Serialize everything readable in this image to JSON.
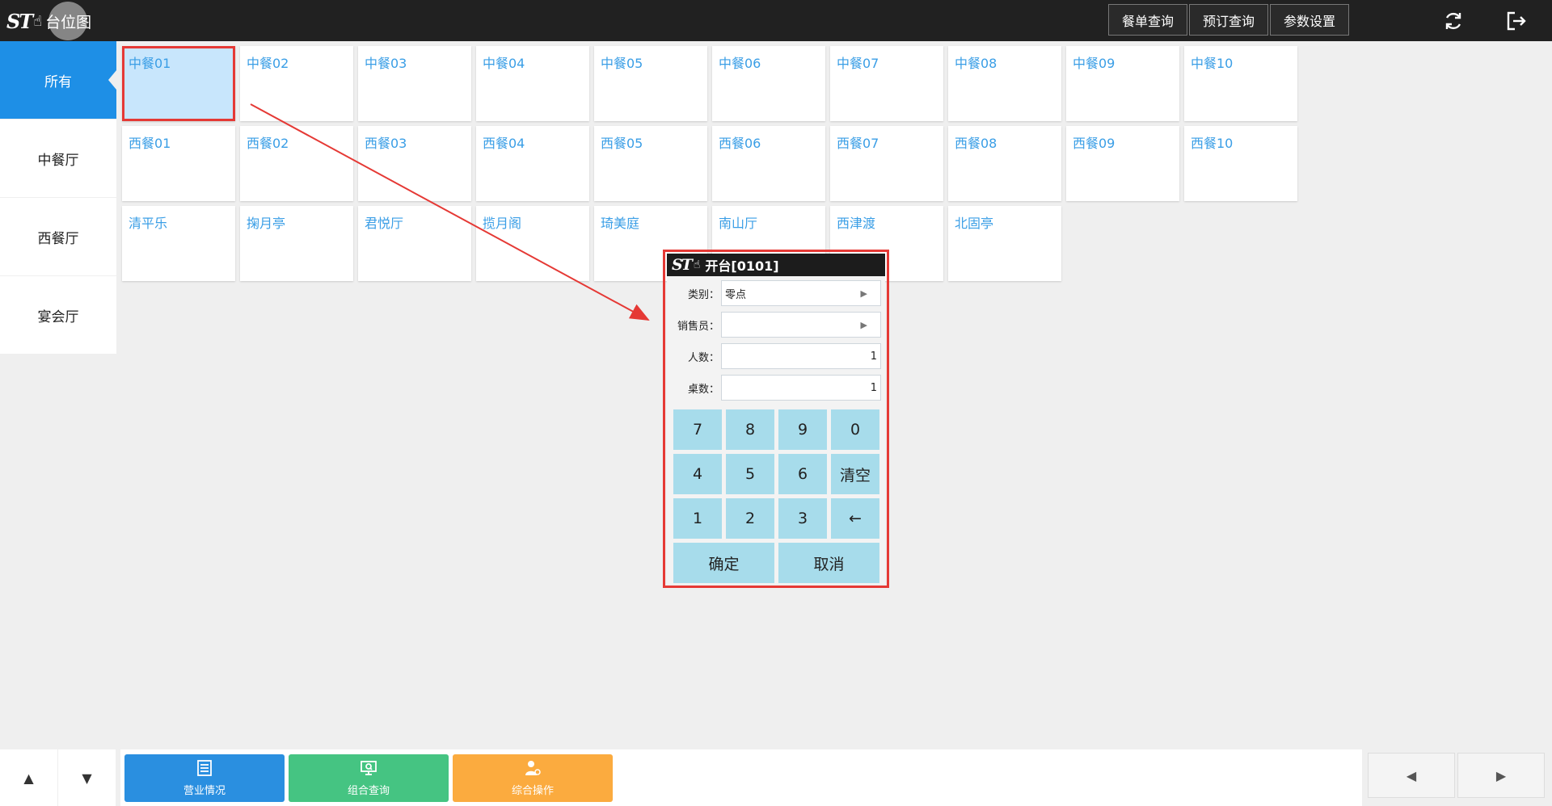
{
  "app": {
    "title": "台位图"
  },
  "topnav": {
    "items": [
      "餐单查询",
      "预订查询",
      "参数设置"
    ]
  },
  "sidebar": {
    "items": [
      {
        "label": "所有",
        "active": true
      },
      {
        "label": "中餐厅",
        "active": false
      },
      {
        "label": "西餐厅",
        "active": false
      },
      {
        "label": "宴会厅",
        "active": false
      }
    ]
  },
  "tables": {
    "rows": [
      [
        "中餐01",
        "中餐02",
        "中餐03",
        "中餐04",
        "中餐05",
        "中餐06",
        "中餐07",
        "中餐08",
        "中餐09",
        "中餐10"
      ],
      [
        "西餐01",
        "西餐02",
        "西餐03",
        "西餐04",
        "西餐05",
        "西餐06",
        "西餐07",
        "西餐08",
        "西餐09",
        "西餐10"
      ],
      [
        "清平乐",
        "掬月亭",
        "君悦厅",
        "揽月阁",
        "琦美庭",
        "南山厅",
        "西津渡",
        "北固亭"
      ]
    ],
    "selected": "中餐01"
  },
  "dialog": {
    "title": "开台[0101]",
    "fields": {
      "category_label": "类别：",
      "category_value": "零点",
      "salesperson_label": "销售员：",
      "salesperson_value": "",
      "people_label": "人数：",
      "people_value": "1",
      "tables_label": "桌数：",
      "tables_value": "1"
    },
    "keypad": {
      "k7": "7",
      "k8": "8",
      "k9": "9",
      "k0": "0",
      "k4": "4",
      "k5": "5",
      "k6": "6",
      "clear": "清空",
      "k1": "1",
      "k2": "2",
      "k3": "3",
      "backspace": "←",
      "confirm": "确定",
      "cancel": "取消"
    }
  },
  "bottom": {
    "actions": [
      {
        "label": "营业情况",
        "color": "#2a8fe0"
      },
      {
        "label": "组合查询",
        "color": "#45c482"
      },
      {
        "label": "综合操作",
        "color": "#fbab3f"
      }
    ]
  },
  "colors": {
    "accent": "#1e8fe6",
    "highlight": "#e53935",
    "table_text": "#3a9ee6",
    "keypad": "#a7dceb"
  }
}
